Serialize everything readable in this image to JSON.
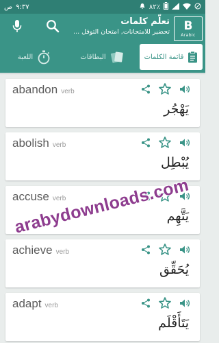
{
  "status_bar": {
    "carrier": "ص",
    "time": "٩:٣٧",
    "battery": "٨٢٪"
  },
  "header": {
    "logo_mark": "B",
    "logo_lang": "Arabic",
    "title": "تعلّم كلمات",
    "subtitle": "تحضير للامتحانات, امتحان التوفل ...",
    "icons": [
      "mic-icon",
      "search-icon"
    ]
  },
  "tabs": [
    {
      "label": "قائمة الكلمات",
      "icon": "clipboard-icon",
      "active": true
    },
    {
      "label": "البطاقات",
      "icon": "cards-icon",
      "active": false
    },
    {
      "label": "اللعبة",
      "icon": "stopwatch-icon",
      "active": false
    }
  ],
  "words": [
    {
      "word": "abandon",
      "pos": "verb",
      "translation": "يَهْجُر"
    },
    {
      "word": "abolish",
      "pos": "verb",
      "translation": "يُبْطِل"
    },
    {
      "word": "accuse",
      "pos": "verb",
      "translation": "يَتَّهِم"
    },
    {
      "word": "achieve",
      "pos": "verb",
      "translation": "يُحَقِّق"
    },
    {
      "word": "adapt",
      "pos": "verb",
      "translation": "يَتَأَقْلَم"
    }
  ],
  "watermark": "arabydownloads.com",
  "colors": {
    "primary": "#3a9487",
    "status_bar": "#2f7f74",
    "icon_accent": "#3a9487",
    "watermark": "#8e3d8f"
  }
}
